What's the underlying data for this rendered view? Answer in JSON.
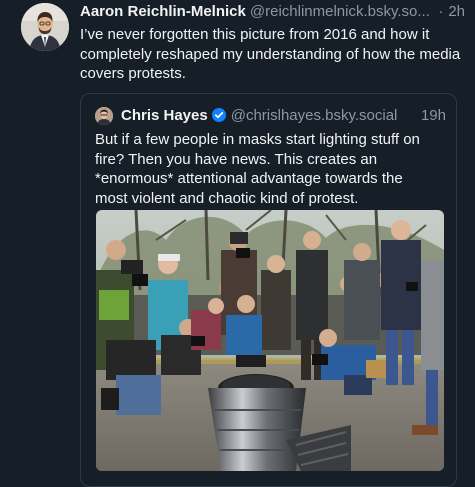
{
  "post": {
    "author_name": "Aaron Reichlin-Melnick",
    "author_handle": "@reichlinmelnick.bsky.so...",
    "separator": "·",
    "time": "2h",
    "text": "I’ve never forgotten this picture from 2016 and how it completely reshaped my understanding of how the media covers protests."
  },
  "quote": {
    "author_name": "Chris Hayes",
    "author_handle": "@chrislhayes.bsky.social",
    "time": "19h",
    "text": "But if a few people in masks start lighting stuff on fire? Then you have news. This creates an *enormous* attentional advantage towards the most violent and chaotic kind of protest."
  },
  "colors": {
    "background": "#161e27",
    "text": "#f1f3f5",
    "muted": "#8b98a5",
    "border": "#2e3a48",
    "verified": "#1083fe"
  },
  "icons": {
    "verified": "verified-badge-icon"
  }
}
